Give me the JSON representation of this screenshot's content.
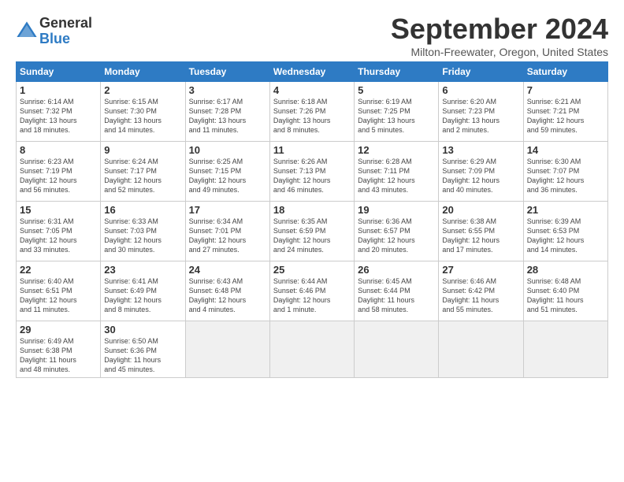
{
  "logo": {
    "general": "General",
    "blue": "Blue"
  },
  "title": "September 2024",
  "location": "Milton-Freewater, Oregon, United States",
  "headers": [
    "Sunday",
    "Monday",
    "Tuesday",
    "Wednesday",
    "Thursday",
    "Friday",
    "Saturday"
  ],
  "weeks": [
    [
      {
        "day": 1,
        "lines": [
          "Sunrise: 6:14 AM",
          "Sunset: 7:32 PM",
          "Daylight: 13 hours",
          "and 18 minutes."
        ]
      },
      {
        "day": 2,
        "lines": [
          "Sunrise: 6:15 AM",
          "Sunset: 7:30 PM",
          "Daylight: 13 hours",
          "and 14 minutes."
        ]
      },
      {
        "day": 3,
        "lines": [
          "Sunrise: 6:17 AM",
          "Sunset: 7:28 PM",
          "Daylight: 13 hours",
          "and 11 minutes."
        ]
      },
      {
        "day": 4,
        "lines": [
          "Sunrise: 6:18 AM",
          "Sunset: 7:26 PM",
          "Daylight: 13 hours",
          "and 8 minutes."
        ]
      },
      {
        "day": 5,
        "lines": [
          "Sunrise: 6:19 AM",
          "Sunset: 7:25 PM",
          "Daylight: 13 hours",
          "and 5 minutes."
        ]
      },
      {
        "day": 6,
        "lines": [
          "Sunrise: 6:20 AM",
          "Sunset: 7:23 PM",
          "Daylight: 13 hours",
          "and 2 minutes."
        ]
      },
      {
        "day": 7,
        "lines": [
          "Sunrise: 6:21 AM",
          "Sunset: 7:21 PM",
          "Daylight: 12 hours",
          "and 59 minutes."
        ]
      }
    ],
    [
      {
        "day": 8,
        "lines": [
          "Sunrise: 6:23 AM",
          "Sunset: 7:19 PM",
          "Daylight: 12 hours",
          "and 56 minutes."
        ]
      },
      {
        "day": 9,
        "lines": [
          "Sunrise: 6:24 AM",
          "Sunset: 7:17 PM",
          "Daylight: 12 hours",
          "and 52 minutes."
        ]
      },
      {
        "day": 10,
        "lines": [
          "Sunrise: 6:25 AM",
          "Sunset: 7:15 PM",
          "Daylight: 12 hours",
          "and 49 minutes."
        ]
      },
      {
        "day": 11,
        "lines": [
          "Sunrise: 6:26 AM",
          "Sunset: 7:13 PM",
          "Daylight: 12 hours",
          "and 46 minutes."
        ]
      },
      {
        "day": 12,
        "lines": [
          "Sunrise: 6:28 AM",
          "Sunset: 7:11 PM",
          "Daylight: 12 hours",
          "and 43 minutes."
        ]
      },
      {
        "day": 13,
        "lines": [
          "Sunrise: 6:29 AM",
          "Sunset: 7:09 PM",
          "Daylight: 12 hours",
          "and 40 minutes."
        ]
      },
      {
        "day": 14,
        "lines": [
          "Sunrise: 6:30 AM",
          "Sunset: 7:07 PM",
          "Daylight: 12 hours",
          "and 36 minutes."
        ]
      }
    ],
    [
      {
        "day": 15,
        "lines": [
          "Sunrise: 6:31 AM",
          "Sunset: 7:05 PM",
          "Daylight: 12 hours",
          "and 33 minutes."
        ]
      },
      {
        "day": 16,
        "lines": [
          "Sunrise: 6:33 AM",
          "Sunset: 7:03 PM",
          "Daylight: 12 hours",
          "and 30 minutes."
        ]
      },
      {
        "day": 17,
        "lines": [
          "Sunrise: 6:34 AM",
          "Sunset: 7:01 PM",
          "Daylight: 12 hours",
          "and 27 minutes."
        ]
      },
      {
        "day": 18,
        "lines": [
          "Sunrise: 6:35 AM",
          "Sunset: 6:59 PM",
          "Daylight: 12 hours",
          "and 24 minutes."
        ]
      },
      {
        "day": 19,
        "lines": [
          "Sunrise: 6:36 AM",
          "Sunset: 6:57 PM",
          "Daylight: 12 hours",
          "and 20 minutes."
        ]
      },
      {
        "day": 20,
        "lines": [
          "Sunrise: 6:38 AM",
          "Sunset: 6:55 PM",
          "Daylight: 12 hours",
          "and 17 minutes."
        ]
      },
      {
        "day": 21,
        "lines": [
          "Sunrise: 6:39 AM",
          "Sunset: 6:53 PM",
          "Daylight: 12 hours",
          "and 14 minutes."
        ]
      }
    ],
    [
      {
        "day": 22,
        "lines": [
          "Sunrise: 6:40 AM",
          "Sunset: 6:51 PM",
          "Daylight: 12 hours",
          "and 11 minutes."
        ]
      },
      {
        "day": 23,
        "lines": [
          "Sunrise: 6:41 AM",
          "Sunset: 6:49 PM",
          "Daylight: 12 hours",
          "and 8 minutes."
        ]
      },
      {
        "day": 24,
        "lines": [
          "Sunrise: 6:43 AM",
          "Sunset: 6:48 PM",
          "Daylight: 12 hours",
          "and 4 minutes."
        ]
      },
      {
        "day": 25,
        "lines": [
          "Sunrise: 6:44 AM",
          "Sunset: 6:46 PM",
          "Daylight: 12 hours",
          "and 1 minute."
        ]
      },
      {
        "day": 26,
        "lines": [
          "Sunrise: 6:45 AM",
          "Sunset: 6:44 PM",
          "Daylight: 11 hours",
          "and 58 minutes."
        ]
      },
      {
        "day": 27,
        "lines": [
          "Sunrise: 6:46 AM",
          "Sunset: 6:42 PM",
          "Daylight: 11 hours",
          "and 55 minutes."
        ]
      },
      {
        "day": 28,
        "lines": [
          "Sunrise: 6:48 AM",
          "Sunset: 6:40 PM",
          "Daylight: 11 hours",
          "and 51 minutes."
        ]
      }
    ],
    [
      {
        "day": 29,
        "lines": [
          "Sunrise: 6:49 AM",
          "Sunset: 6:38 PM",
          "Daylight: 11 hours",
          "and 48 minutes."
        ]
      },
      {
        "day": 30,
        "lines": [
          "Sunrise: 6:50 AM",
          "Sunset: 6:36 PM",
          "Daylight: 11 hours",
          "and 45 minutes."
        ]
      },
      null,
      null,
      null,
      null,
      null
    ]
  ]
}
